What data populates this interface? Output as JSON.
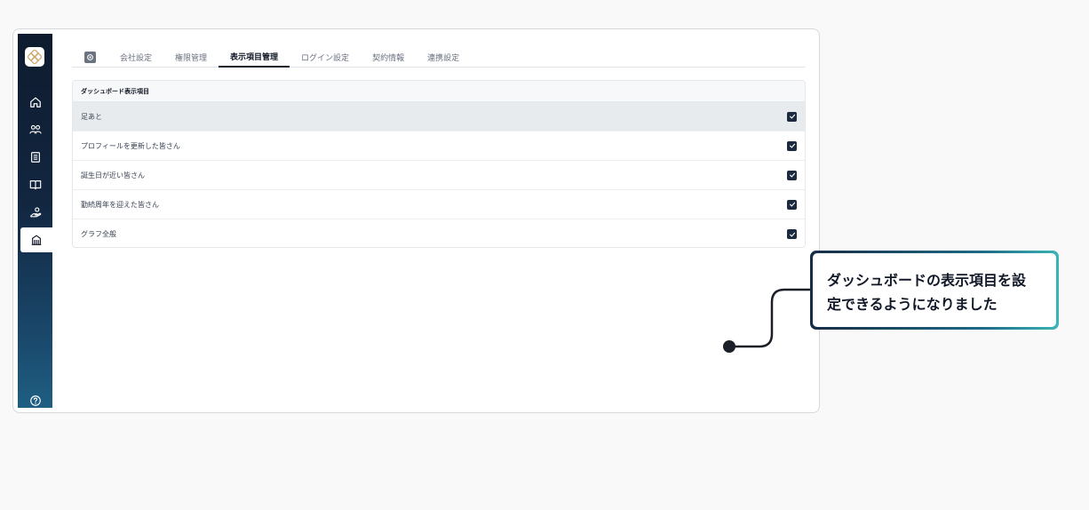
{
  "sidebar": {
    "items": [
      {
        "icon": "home-icon"
      },
      {
        "icon": "users-icon"
      },
      {
        "icon": "document-list-icon"
      },
      {
        "icon": "book-icon"
      },
      {
        "icon": "hand-icon"
      },
      {
        "icon": "building-icon",
        "active": true
      }
    ],
    "help_icon": "help-circle-icon"
  },
  "tabs": [
    {
      "label": "会社設定"
    },
    {
      "label": "権限管理"
    },
    {
      "label": "表示項目管理",
      "active": true
    },
    {
      "label": "ログイン設定"
    },
    {
      "label": "契約情報"
    },
    {
      "label": "連携設定"
    }
  ],
  "card": {
    "header": "ダッシュボード表示項目",
    "rows": [
      {
        "label": "足あと",
        "checked": true
      },
      {
        "label": "プロフィールを更新した皆さん",
        "checked": true
      },
      {
        "label": "誕生日が近い皆さん",
        "checked": true
      },
      {
        "label": "勤続周年を迎えた皆さん",
        "checked": true
      },
      {
        "label": "グラフ全般",
        "checked": true
      }
    ]
  },
  "callout": {
    "line1": "ダッシュボードの表示項目を設",
    "line2": "定できるようになりました"
  },
  "colors": {
    "sidebar_top": "#0e1b2e",
    "sidebar_bottom": "#1f5f82",
    "checkbox": "#1b2a3f",
    "callout_gradient_end": "#3ab5b6"
  }
}
